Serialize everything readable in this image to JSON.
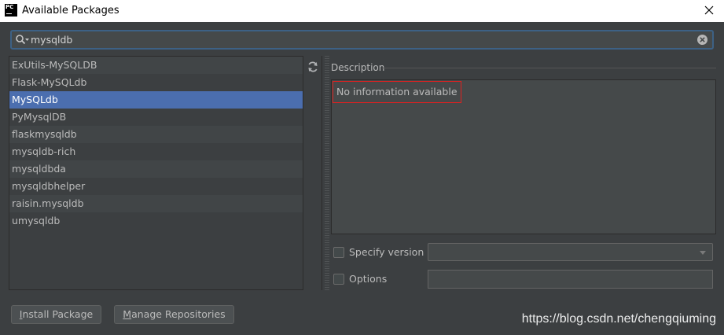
{
  "window": {
    "title": "Available Packages",
    "app_icon_text": "PC"
  },
  "search": {
    "value": "mysqldb",
    "placeholder": ""
  },
  "packages": [
    {
      "name": "ExUtils-MySQLDB",
      "selected": false
    },
    {
      "name": "Flask-MySQLdb",
      "selected": false
    },
    {
      "name": "MySQLdb",
      "selected": true
    },
    {
      "name": "PyMysqlDB",
      "selected": false
    },
    {
      "name": "flaskmysqldb",
      "selected": false
    },
    {
      "name": "mysqldb-rich",
      "selected": false
    },
    {
      "name": "mysqldbda",
      "selected": false
    },
    {
      "name": "mysqldbhelper",
      "selected": false
    },
    {
      "name": "raisin.mysqldb",
      "selected": false
    },
    {
      "name": "umysqldb",
      "selected": false
    }
  ],
  "description": {
    "label": "Description",
    "text": "No information available"
  },
  "options": {
    "specify_version_label": "Specify version",
    "specify_version_checked": false,
    "version_value": "",
    "options_label": "Options",
    "options_checked": false,
    "options_value": ""
  },
  "buttons": {
    "install_mnemonic": "I",
    "install_rest": "nstall Package",
    "manage_mnemonic": "M",
    "manage_rest": "anage Repositories"
  },
  "watermark": "https://blog.csdn.net/chengqiuming",
  "colors": {
    "background": "#3c3f41",
    "selection": "#4b6eaf",
    "search_focus_border": "#3d6185",
    "highlight_box": "#e02020"
  },
  "icons": {
    "search": "search-icon",
    "clear": "clear-icon",
    "refresh": "refresh-icon",
    "close": "close-icon",
    "dropdown": "chevron-down-icon"
  }
}
